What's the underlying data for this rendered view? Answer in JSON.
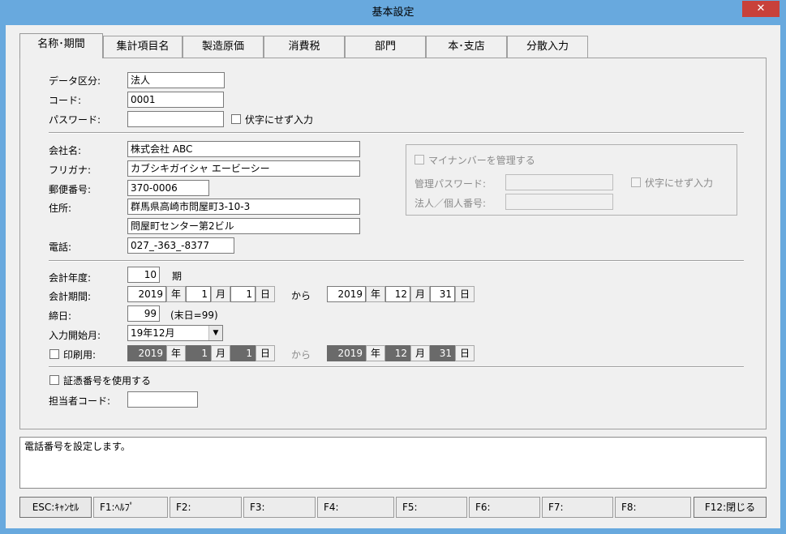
{
  "window": {
    "title": "基本設定",
    "close_glyph": "✕"
  },
  "tabs": [
    {
      "label": "名称･期間",
      "active": true
    },
    {
      "label": "集計項目名"
    },
    {
      "label": "製造原価"
    },
    {
      "label": "消費税"
    },
    {
      "label": "部門"
    },
    {
      "label": "本･支店"
    },
    {
      "label": "分散入力"
    }
  ],
  "basic": {
    "data_type_label": "データ区分:",
    "data_type_value": "法人",
    "code_label": "コード:",
    "code_value": "0001",
    "password_label": "パスワード:",
    "password_value": "",
    "mask_label": "伏字にせず入力"
  },
  "company": {
    "name_label": "会社名:",
    "name_value": "株式会社  ABC",
    "kana_label": "フリガナ:",
    "kana_value": "カブシキガイシャ  エービーシー",
    "zip_label": "郵便番号:",
    "zip_value": "370-0006",
    "address_label": "住所:",
    "address1_value": "群馬県高崎市問屋町3-10-3",
    "address2_value": "問屋町センター第2ビル",
    "phone_label": "電話:",
    "phone_value": "027_-363_-8377"
  },
  "mynumber": {
    "manage_label": "マイナンバーを管理する",
    "admin_pw_label": "管理パスワード:",
    "admin_pw_value": "",
    "mask_label": "伏字にせず入力",
    "corp_no_label": "法人／個人番号:",
    "corp_no_value": ""
  },
  "period": {
    "fiscal_year_label": "会計年度:",
    "fiscal_year_value": "10",
    "fiscal_year_unit": "期",
    "period_label": "会計期間:",
    "from": {
      "year": "2019",
      "month": "1",
      "day": "1"
    },
    "to": {
      "year": "2019",
      "month": "12",
      "day": "31"
    },
    "unit_year": "年",
    "unit_month": "月",
    "unit_day": "日",
    "from_word": "から",
    "closing_label": "締日:",
    "closing_value": "99",
    "closing_note": "(末日=99)",
    "start_month_label": "入力開始月:",
    "start_month_value": "19年12月",
    "print_label": "印刷用:",
    "print_from": {
      "year": "2019",
      "month": "1",
      "day": "1"
    },
    "print_to": {
      "year": "2019",
      "month": "12",
      "day": "31"
    }
  },
  "voucher": {
    "use_label": "証憑番号を使用する",
    "staff_label": "担当者コード:",
    "staff_value": ""
  },
  "status_text": "電話番号を設定します。",
  "fkeys": [
    "ESC:ｷｬﾝｾﾙ",
    "F1:ﾍﾙﾌﾟ",
    "F2:",
    "F3:",
    "F4:",
    "F5:",
    "F6:",
    "F7:",
    "F8:",
    "F12:閉じる"
  ],
  "icons": {
    "dropdown": "▼",
    "close": "close-icon"
  }
}
